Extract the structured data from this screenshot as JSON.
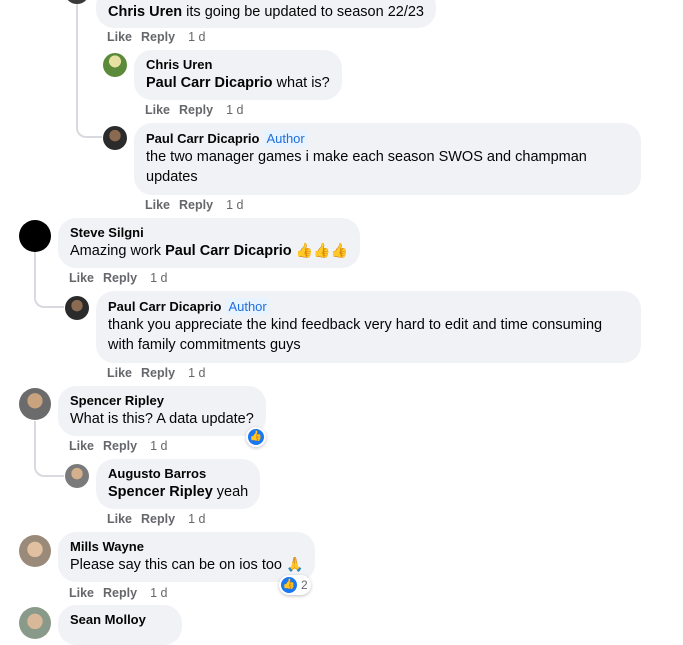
{
  "actions": {
    "like": "Like",
    "reply": "Reply",
    "time": "1 d"
  },
  "badges": {
    "author": "Author"
  },
  "comments": [
    {
      "id": "c1",
      "author": "",
      "mention": "Chris Uren",
      "text": " its going be updated to season 22/23"
    },
    {
      "id": "c2",
      "author": "Chris Uren",
      "mention": "Paul Carr Dicaprio",
      "text": " what is?"
    },
    {
      "id": "c3",
      "author": "Paul Carr Dicaprio",
      "author_badge": "Author",
      "text_line1": "the two manager games i make each season SWOS and champman",
      "text_line2": "updates"
    },
    {
      "id": "c4",
      "author": "Steve Silgni",
      "text": "Amazing work ",
      "mention": "Paul Carr Dicaprio",
      "emoji": "👍👍👍"
    },
    {
      "id": "c5",
      "author": "Paul Carr Dicaprio",
      "author_badge": "Author",
      "text_line1": "thank you appreciate the kind feedback very hard to edit and time consuming",
      "text_line2": "with family commitments guys"
    },
    {
      "id": "c6",
      "author": "Spencer Ripley",
      "text": "What is this? A data update?"
    },
    {
      "id": "c7",
      "author": "Augusto Barros",
      "mention": "Spencer Ripley",
      "text": " yeah"
    },
    {
      "id": "c8",
      "author": "Mills Wayne",
      "text": "Please say this can be on ios too ",
      "emoji": "🙏",
      "reaction_count": "2"
    },
    {
      "id": "c9",
      "author": "Sean Molloy"
    }
  ],
  "colors": {
    "bubble": "#f0f2f5",
    "meta": "#65676b",
    "accent": "#1877f2",
    "author_badge_bg": "#e7f3ff"
  }
}
